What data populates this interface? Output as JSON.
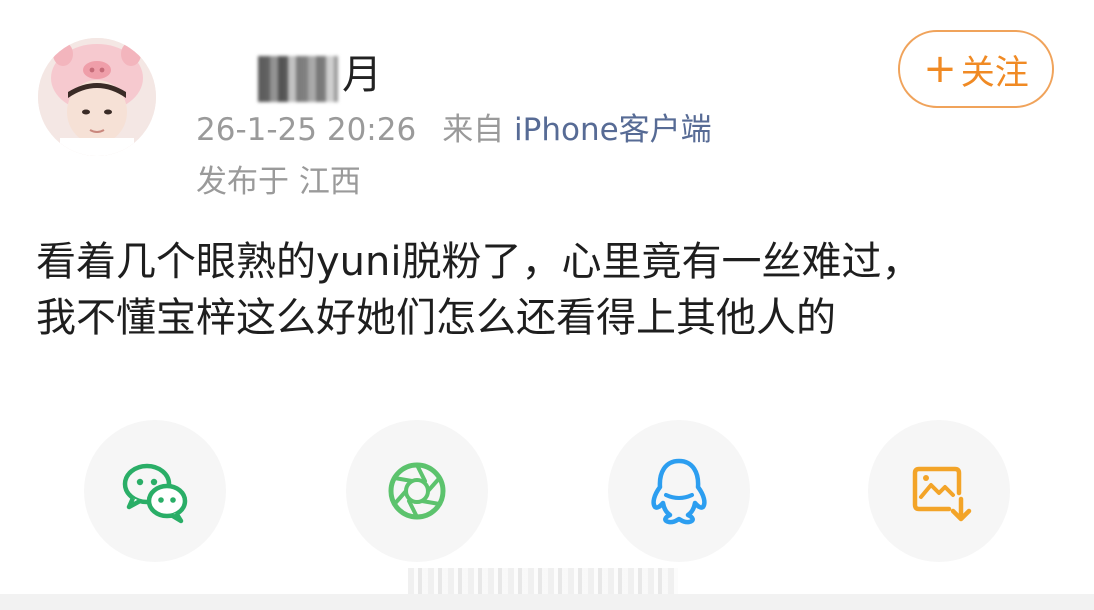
{
  "post": {
    "author": {
      "name_visible": "月"
    },
    "timestamp": "26-1-25 20:26",
    "source_prefix": "来自",
    "source": "iPhone客户端",
    "location": "发布于 江西",
    "text_lines": [
      "看着几个眼熟的yuni脱粉了，心里竟有一丝难过，",
      "我不懂宝梓这么好她们怎么还看得上其他人的"
    ]
  },
  "follow_button": {
    "plus": "+",
    "label": "关注"
  },
  "share": [
    {
      "name": "wechat",
      "icon": "wechat-icon",
      "color": "#2aae67"
    },
    {
      "name": "moments",
      "icon": "moments-icon",
      "color": "#5cc36d"
    },
    {
      "name": "qq",
      "icon": "qq-icon",
      "color": "#2c9ef0"
    },
    {
      "name": "save-image",
      "icon": "save-image-icon",
      "color": "#f3a428"
    }
  ],
  "colors": {
    "accent": "#f08a24",
    "link": "#576b95",
    "meta": "#9a9a9a"
  }
}
